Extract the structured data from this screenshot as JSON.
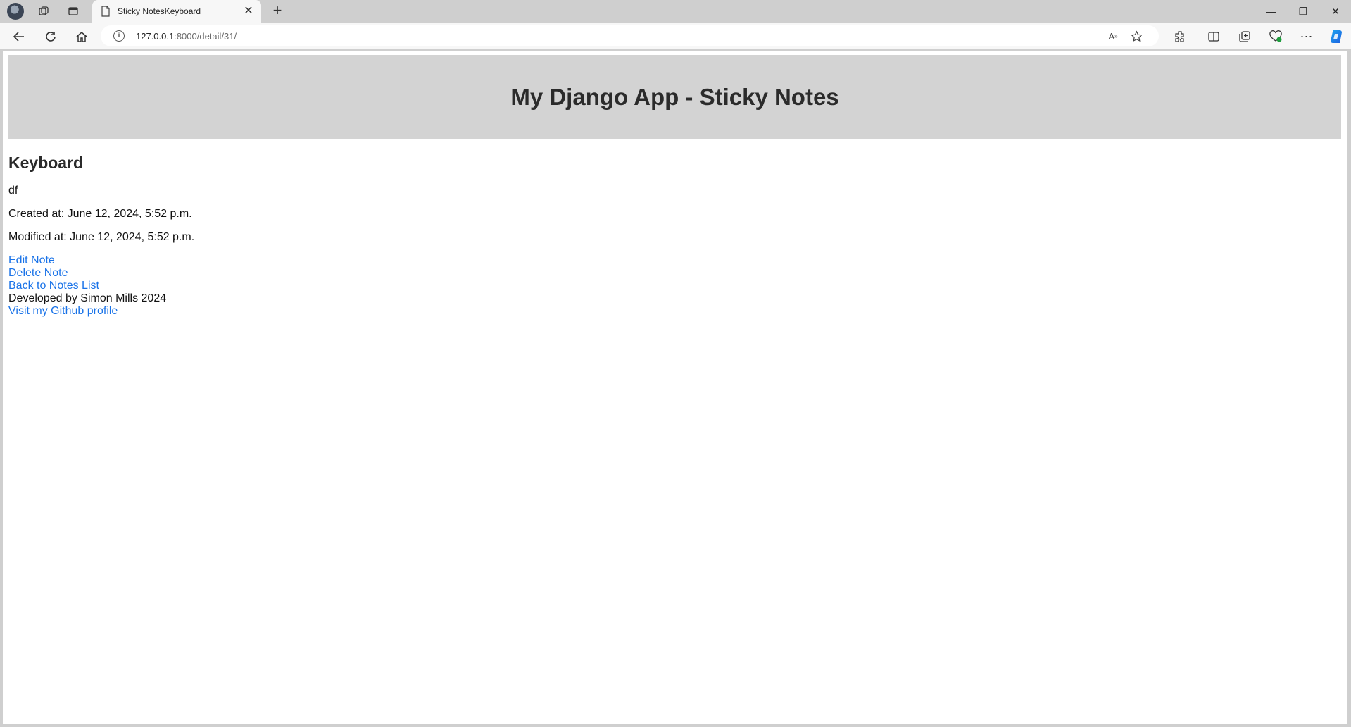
{
  "browser": {
    "tab_title": "Sticky NotesKeyboard",
    "url_host": "127.0.0.1",
    "url_rest": ":8000/detail/31/"
  },
  "page": {
    "header_title": "My Django App - Sticky Notes",
    "note_title": "Keyboard",
    "note_body": "df",
    "created": "Created at: June 12, 2024, 5:52 p.m.",
    "modified": "Modified at: June 12, 2024, 5:52 p.m.",
    "edit_link": "Edit Note",
    "delete_link": "Delete Note",
    "back_link": "Back to Notes List",
    "developer": "Developed by Simon Mills 2024",
    "github_link": "Visit my Github profile"
  },
  "colors": {
    "link": "#1a73e8",
    "header_bg": "#d3d3d3",
    "chrome_bg": "#cfcfcf"
  }
}
